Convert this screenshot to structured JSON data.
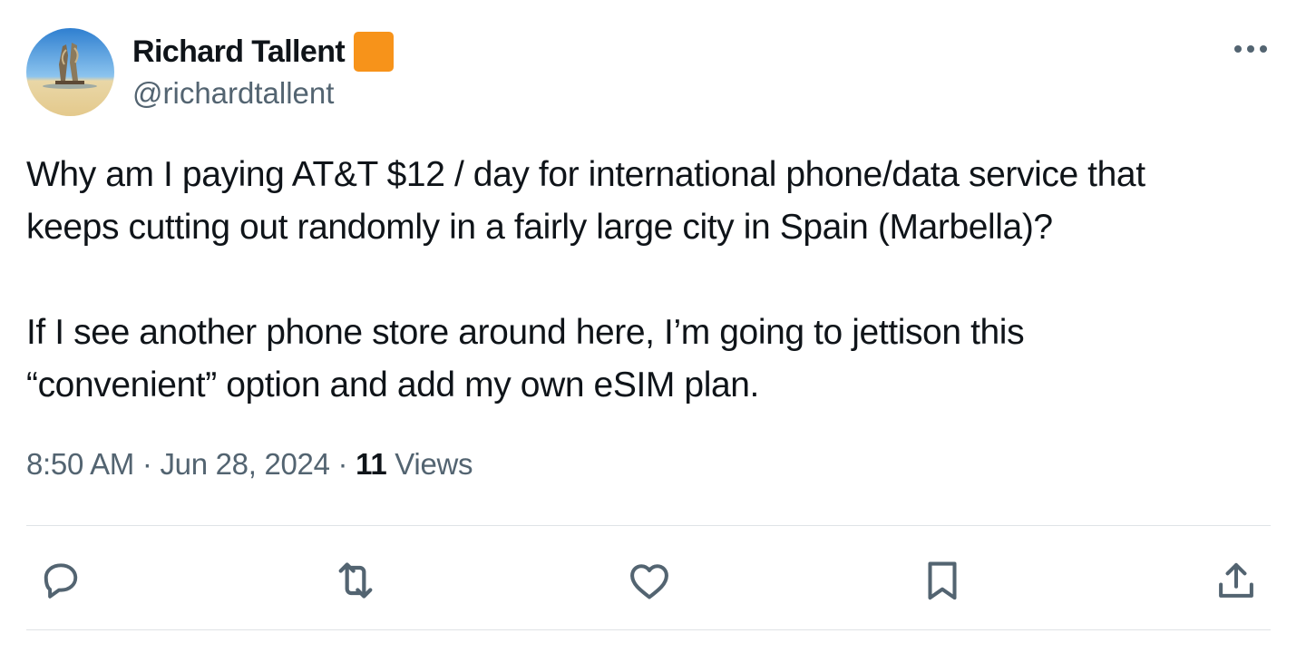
{
  "author": {
    "display_name": "Richard Tallent",
    "handle": "@richardtallent",
    "badge_color": "#f7931a",
    "avatar": "beach-sculpture-avatar"
  },
  "tweet": {
    "paragraphs": [
      "Why am I paying AT&T $12 / day for international phone/data service that\nkeeps cutting out randomly in a fairly large city in Spain (Marbella)?",
      "If I see another phone store around here, I’m going to jettison this\n“convenient” option and add my own eSIM plan."
    ],
    "time": "8:50 AM",
    "separator": "·",
    "date": "Jun 28, 2024",
    "views_count": "11",
    "views_label": "Views"
  },
  "actions": {
    "reply_icon": "reply-icon",
    "retweet_icon": "retweet-icon",
    "like_icon": "heart-icon",
    "bookmark_icon": "bookmark-icon",
    "share_icon": "share-icon"
  },
  "colors": {
    "text_primary": "#0f1419",
    "text_secondary": "#536471",
    "divider": "#dfe3e6"
  }
}
